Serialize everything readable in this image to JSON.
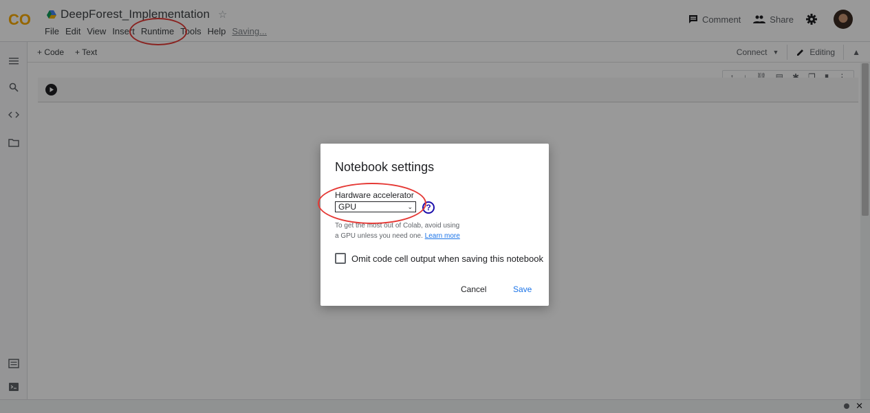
{
  "app": {
    "notebook_title": "DeepForest_Implementation",
    "menu": [
      "File",
      "Edit",
      "View",
      "Insert",
      "Runtime",
      "Tools",
      "Help"
    ],
    "save_status": "Saving...",
    "comment_label": "Comment",
    "share_label": "Share"
  },
  "toolbar": {
    "add_code": "+ Code",
    "add_text": "+ Text",
    "connect": "Connect",
    "editing": "Editing"
  },
  "dialog": {
    "title": "Notebook settings",
    "hardware_label": "Hardware accelerator",
    "hardware_value": "GPU",
    "hint_line1": "To get the most out of Colab, avoid using",
    "hint_line2": "a GPU unless you need one.",
    "learn_more": "Learn more",
    "omit_label": "Omit code cell output when saving this notebook",
    "omit_checked": false,
    "cancel": "Cancel",
    "save": "Save"
  },
  "colors": {
    "accent": "#1a73e8",
    "annotation": "#e53935",
    "logo_orange": "#f9ab00"
  }
}
